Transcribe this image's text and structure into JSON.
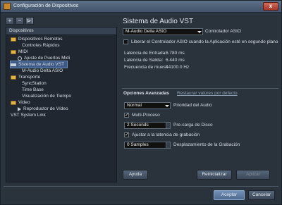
{
  "window": {
    "title": "Configuración de Dispositivos",
    "close_label": "x"
  },
  "toolbar": {
    "add_label": "+",
    "remove_label": "−",
    "reset_label": "⊳|"
  },
  "tree": {
    "header": "Dispositivos",
    "items": [
      {
        "label": "Dispositivos Remotos"
      },
      {
        "label": "Controles Rápidos"
      },
      {
        "label": "MIDI"
      },
      {
        "label": "Ajuste de Puertos Midi"
      },
      {
        "label": "Sistema de Audio VST"
      },
      {
        "label": "M-Audio Delta ASIO"
      },
      {
        "label": "Transporte"
      },
      {
        "label": "SyncStation"
      },
      {
        "label": "Time Base"
      },
      {
        "label": "Visualización de Tiempo"
      },
      {
        "label": "Video"
      },
      {
        "label": "Reproductor de Vídeo"
      },
      {
        "label": "VST System Link"
      }
    ]
  },
  "panel": {
    "title": "Sistema de Audio VST",
    "driver": {
      "value": "M-Audio Delta ASIO",
      "label": "Controlador ASIO"
    },
    "release_driver": {
      "label": "Liberar el Controlador ASIO cuando la Aplicación esté en segundo plano",
      "checked": false
    },
    "latency_in": {
      "label": "Latencia de Entrada:",
      "value": "6.780 ms"
    },
    "latency_out": {
      "label": "Latencia de Salida:",
      "value": "6.440 ms"
    },
    "sample_rate": {
      "label": "Frecuencia de muest",
      "value": "44100.0 Hz"
    },
    "advanced": {
      "label": "Opciones Avanzadas",
      "reset_link": "Restaurar valores por defecto"
    },
    "priority": {
      "value": "Normal",
      "label": "Prioridad del Audio"
    },
    "multiprocess": {
      "label": "Multi-Proceso",
      "checked": true
    },
    "preload": {
      "value": "2 Seconds",
      "label": "Pre-carga de Disco"
    },
    "adjust_latency": {
      "label": "Ajustar a la latencia de grabación",
      "checked": true
    },
    "record_offset": {
      "value": "0 Samples",
      "label": "Desplazamiento de la Grabación"
    }
  },
  "buttons": {
    "help": "Ayuda",
    "reset": "Reinicializar",
    "apply": "Aplicar",
    "ok": "Aceptar",
    "cancel": "Cancelar"
  }
}
